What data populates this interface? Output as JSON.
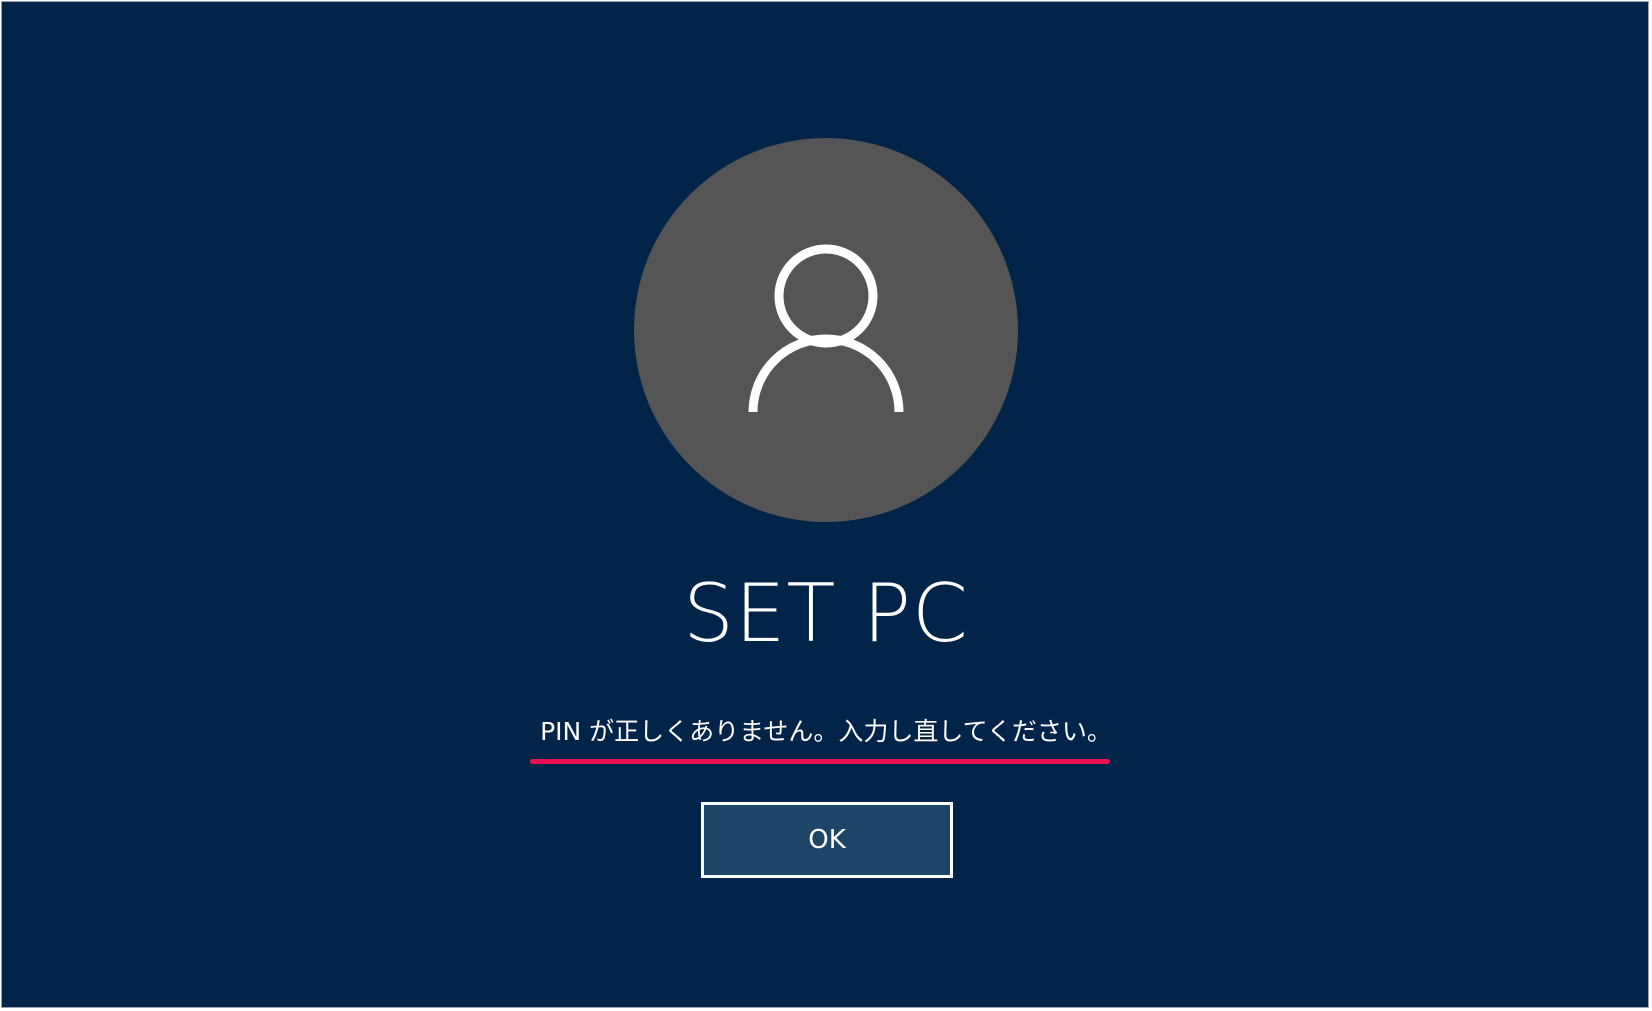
{
  "lock_screen": {
    "avatar_icon": "user-icon",
    "user_name": "SET PC",
    "error_message": "PIN が正しくありません。入力し直してください。",
    "ok_label": "OK"
  },
  "colors": {
    "background": "#022448",
    "avatar_background": "#555555",
    "button_background": "#1d4567",
    "highlight_underline": "#e8104f"
  }
}
